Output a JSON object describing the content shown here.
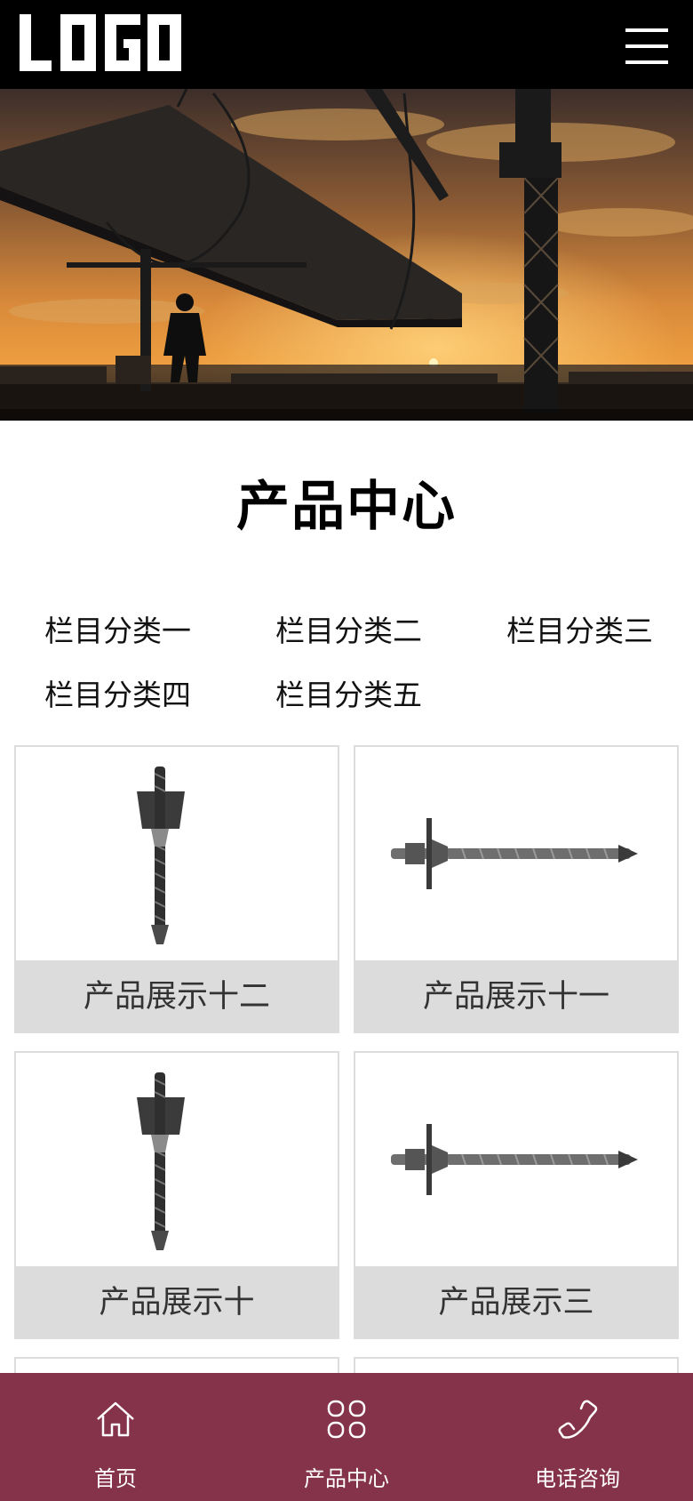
{
  "header": {
    "logo_text": "LOGO",
    "menu_icon": "hamburger-menu-icon"
  },
  "banner": {
    "alt": "construction-site-sunset-banner"
  },
  "section": {
    "title": "产品中心"
  },
  "categories": [
    {
      "label": "栏目分类一"
    },
    {
      "label": "栏目分类二"
    },
    {
      "label": "栏目分类三"
    },
    {
      "label": "栏目分类四"
    },
    {
      "label": "栏目分类五"
    }
  ],
  "products": [
    {
      "name": "产品展示十二",
      "image": "anchor-bolt-vertical"
    },
    {
      "name": "产品展示十一",
      "image": "anchor-bolt-horizontal"
    },
    {
      "name": "产品展示十",
      "image": "anchor-bolt-vertical"
    },
    {
      "name": "产品展示三",
      "image": "anchor-bolt-horizontal"
    }
  ],
  "bottom_nav": [
    {
      "label": "首页",
      "icon": "home-icon"
    },
    {
      "label": "产品中心",
      "icon": "grid-icon"
    },
    {
      "label": "电话咨询",
      "icon": "phone-icon"
    }
  ],
  "colors": {
    "header_bg": "#000000",
    "nav_bg": "#84334a",
    "caption_bg": "#dcdcdc"
  }
}
